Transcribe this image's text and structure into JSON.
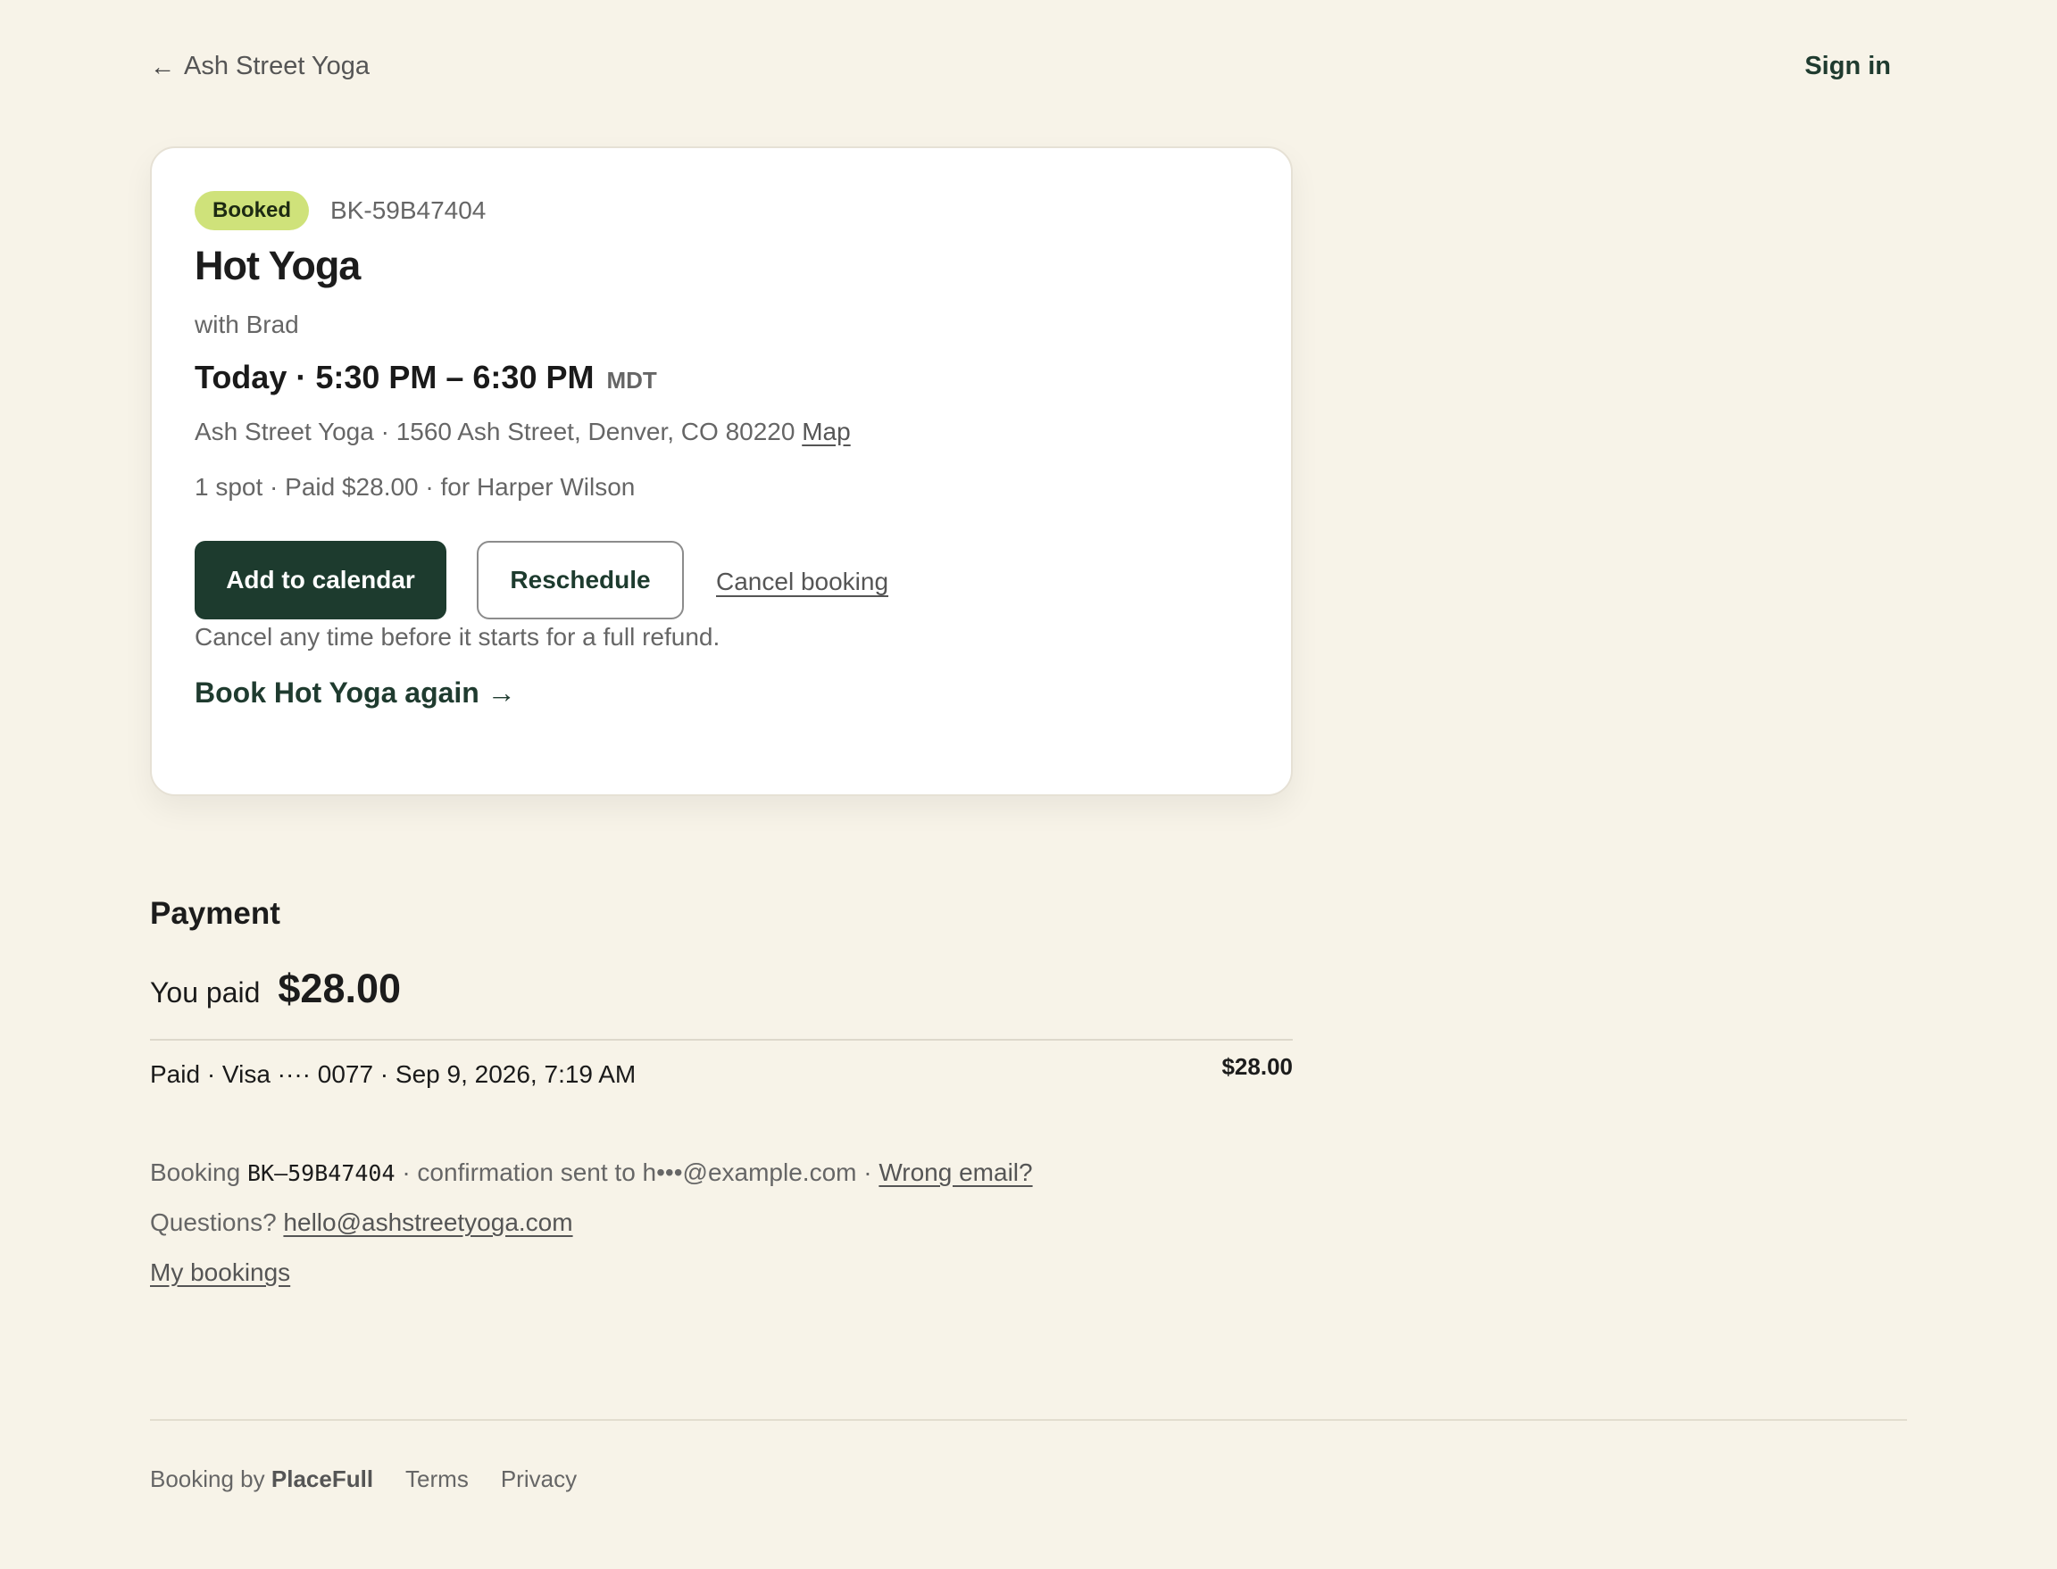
{
  "nav": {
    "back_arrow": "←",
    "back_label": "Ash Street Yoga",
    "sign_in": "Sign in"
  },
  "booking": {
    "status": "Booked",
    "id": "BK-59B47404",
    "class_name": "Hot Yoga",
    "instructor": "with Brad",
    "time": "Today · 5:30 PM – 6:30 PM",
    "timezone": "MDT",
    "address": "Ash Street Yoga · 1560 Ash Street, Denver, CO 80220",
    "map_link": "Map",
    "spot_info": "1 spot · Paid $28.00 · for Harper Wilson",
    "add_to_calendar": "Add to calendar",
    "reschedule": "Reschedule",
    "cancel": "Cancel booking",
    "refund_note": "Cancel any time before it starts for a full refund.",
    "book_again": "Book Hot Yoga again →"
  },
  "payment": {
    "heading": "Payment",
    "you_paid_label": "You paid",
    "you_paid_amount": "$28.00",
    "line_description": "Paid · Visa ···· 0077 · Sep 9, 2026, 7:19 AM",
    "line_amount": "$28.00"
  },
  "info": {
    "booking_prefix": "Booking",
    "booking_id": "BK–59B47404",
    "confirmation": "· confirmation sent to h•••@example.com ·",
    "wrong_email": "Wrong email?",
    "questions_prefix": "Questions?",
    "contact_email": "hello@ashstreetyoga.com",
    "my_bookings": "My bookings"
  },
  "footer": {
    "booking_by": "Booking by",
    "brand": "PlaceFull",
    "terms": "Terms",
    "privacy": "Privacy"
  },
  "colors": {
    "background": "#f7f3e8",
    "primary": "#1d3b2e",
    "badge": "#cfe27a"
  }
}
